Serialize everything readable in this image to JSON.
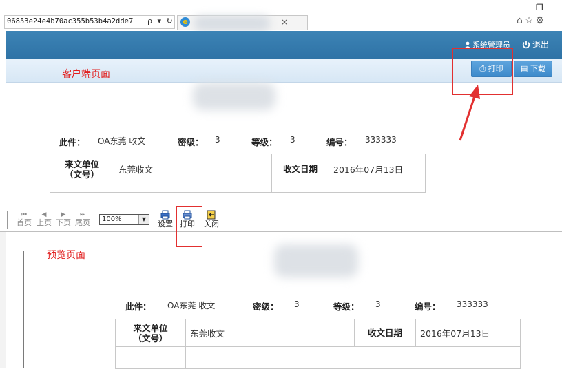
{
  "browser": {
    "url": "06853e24e4b70ac355b53b4a2dde7",
    "url_icons": "ρ ▾ ↻",
    "tab_icon": "e",
    "tab_close": "×",
    "window_controls": "–  ❐",
    "chrome_icons": "⌂☆⚙"
  },
  "client": {
    "user_label": "系统管理员",
    "logout_label": "退出",
    "page_label": "客户端页面",
    "print_label": "打印",
    "download_label": "下载",
    "print_icon": "⎙",
    "download_icon": "▤"
  },
  "preview": {
    "page_label": "预览页面",
    "nav": [
      {
        "glyph": "⏮",
        "label": "首页"
      },
      {
        "glyph": "◀",
        "label": "上页"
      },
      {
        "glyph": "▶",
        "label": "下页"
      },
      {
        "glyph": "⏭",
        "label": "尾页"
      }
    ],
    "zoom": "100%",
    "tools": {
      "settings": "设置",
      "print": "打印",
      "close": "关闭"
    }
  },
  "document": {
    "info": {
      "this_item_label": "此件：",
      "this_item_value": "OA东莞 收文",
      "secret_label": "密级：",
      "secret_value": "3",
      "grade_label": "等级：",
      "grade_value": "3",
      "number_label": "编号：",
      "number_value": "333333"
    },
    "table": {
      "sender_label_line1": "来文单位",
      "sender_label_line2": "（文号）",
      "sender_value": "东莞收文",
      "date_label": "收文日期",
      "date_value": "2016年07月13日"
    }
  },
  "colors": {
    "header_blue": "#3479ad",
    "button_blue": "#4a95d3",
    "annotation_red": "#e21e1e"
  }
}
